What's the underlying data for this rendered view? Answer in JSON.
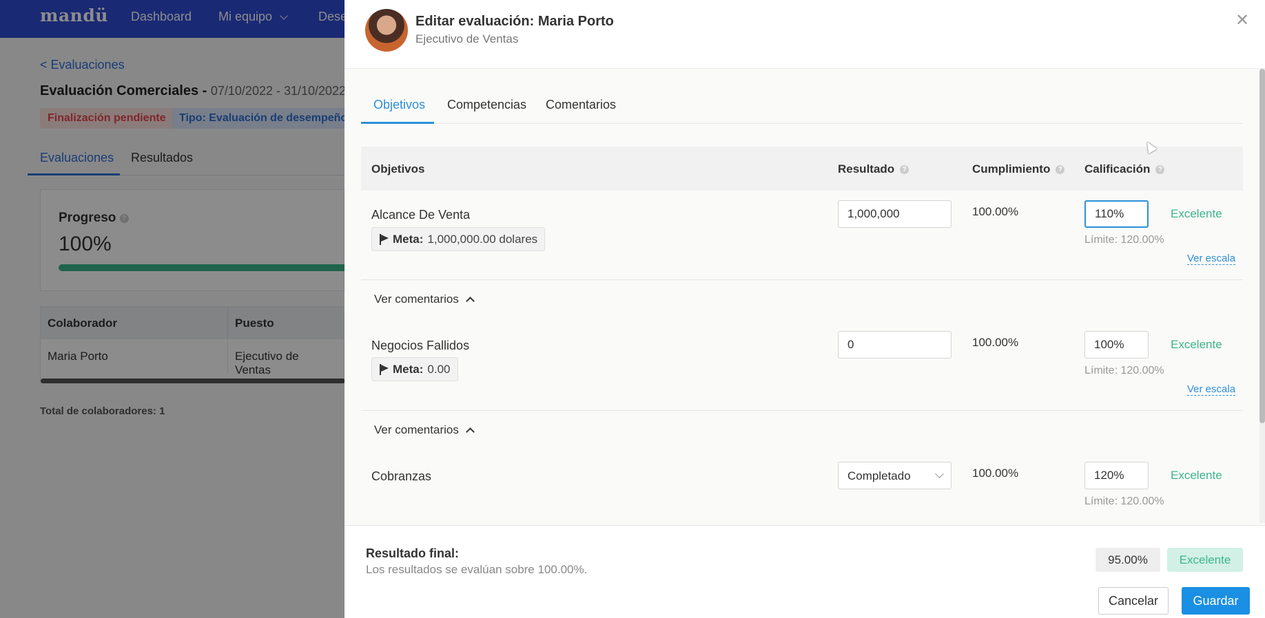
{
  "app": {
    "logo": "mandü",
    "nav": [
      "Dashboard",
      "Mi equipo",
      "Dese"
    ]
  },
  "background": {
    "back_link": "< Evaluaciones",
    "title": "Evaluación Comerciales -",
    "dates": "07/10/2022 - 31/10/2022",
    "badge_status": "Finalización pendiente",
    "badge_type": "Tipo: Evaluación de desempeño",
    "tabs": [
      "Evaluaciones",
      "Resultados"
    ],
    "progress_label": "Progreso",
    "progress_value": "100%",
    "progress_fraction": 1.0,
    "table": {
      "headers": [
        "Colaborador",
        "Puesto"
      ],
      "row": [
        "Maria Porto",
        "Ejecutivo de Ventas"
      ]
    },
    "total": "Total de colaboradores: 1"
  },
  "drawer": {
    "title": "Editar evaluación: Maria Porto",
    "subtitle": "Ejecutivo de Ventas",
    "tabs": [
      "Objetivos",
      "Competencias",
      "Comentarios"
    ],
    "columns": {
      "objetivos": "Objetivos",
      "resultado": "Resultado",
      "cumplimiento": "Cumplimiento",
      "calificacion": "Calificación"
    },
    "objectives": [
      {
        "name": "Alcance De Venta",
        "meta_label": "Meta:",
        "meta_value": "1,000,000.00 dolares",
        "resultado": "1,000,000",
        "cumplimiento": "100.00%",
        "calificacion": "110%",
        "rating": "Excelente",
        "limite": "Límite: 120.00%",
        "ver_escala": "Ver escala"
      },
      {
        "name": "Negocios Fallidos",
        "meta_label": "Meta:",
        "meta_value": "0.00",
        "resultado": "0",
        "cumplimiento": "100.00%",
        "calificacion": "100%",
        "rating": "Excelente",
        "limite": "Límite: 120.00%",
        "ver_escala": "Ver escala"
      },
      {
        "name": "Cobranzas",
        "resultado": "Completado",
        "cumplimiento": "100.00%",
        "calificacion": "120%",
        "rating": "Excelente",
        "limite": "Límite: 120.00%"
      }
    ],
    "ver_comentarios": "Ver comentarios",
    "footer": {
      "final_label": "Resultado final:",
      "final_note": "Los resultados se evalúan sobre 100.00%.",
      "final_pct": "95.00%",
      "final_rating": "Excelente",
      "cancel": "Cancelar",
      "save": "Guardar"
    }
  },
  "colors": {
    "brand": "#2f4bd3",
    "accent": "#2f8fd8",
    "success": "#3bb58b",
    "danger": "#e5484d"
  }
}
